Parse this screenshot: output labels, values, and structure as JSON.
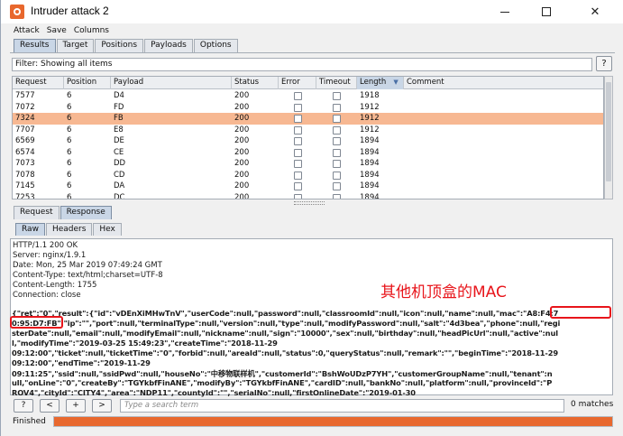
{
  "window": {
    "title": "Intruder attack 2",
    "min_label": "",
    "close_label": "✕"
  },
  "menu": [
    "Attack",
    "Save",
    "Columns"
  ],
  "tabs": [
    "Results",
    "Target",
    "Positions",
    "Payloads",
    "Options"
  ],
  "filter": {
    "text": "Filter: Showing all items",
    "help": "?"
  },
  "table": {
    "columns": [
      "Request",
      "Position",
      "Payload",
      "Status",
      "Error",
      "Timeout",
      "Length",
      "Comment"
    ],
    "sorted_column": "Length",
    "rows": [
      {
        "request": "7577",
        "position": "6",
        "payload": "D4",
        "status": "200",
        "length": "1918"
      },
      {
        "request": "7072",
        "position": "6",
        "payload": "FD",
        "status": "200",
        "length": "1912"
      },
      {
        "request": "7324",
        "position": "6",
        "payload": "FB",
        "status": "200",
        "length": "1912",
        "selected": true
      },
      {
        "request": "7707",
        "position": "6",
        "payload": "E8",
        "status": "200",
        "length": "1912"
      },
      {
        "request": "6569",
        "position": "6",
        "payload": "DE",
        "status": "200",
        "length": "1894"
      },
      {
        "request": "6574",
        "position": "6",
        "payload": "CE",
        "status": "200",
        "length": "1894"
      },
      {
        "request": "7073",
        "position": "6",
        "payload": "DD",
        "status": "200",
        "length": "1894"
      },
      {
        "request": "7078",
        "position": "6",
        "payload": "CD",
        "status": "200",
        "length": "1894"
      },
      {
        "request": "7145",
        "position": "6",
        "payload": "DA",
        "status": "200",
        "length": "1894"
      },
      {
        "request": "7253",
        "position": "6",
        "payload": "DC",
        "status": "200",
        "length": "1894"
      }
    ]
  },
  "rr_tabs": [
    "Request",
    "Response"
  ],
  "view_tabs": [
    "Raw",
    "Headers",
    "Hex"
  ],
  "response": {
    "headers": [
      "HTTP/1.1 200 OK",
      "Server: nginx/1.9.1",
      "Date: Mon, 25 Mar 2019 07:49:24 GMT",
      "Content-Type: text/html;charset=UTF-8",
      "Content-Length: 1755",
      "Connection: close"
    ],
    "annotation": "其他机顶盒的MAC",
    "body_lines": [
      "{\"ret\":\"0\",\"result\":{\"id\":\"vDEnXiMHwTnV\",\"userCode\":null,\"password\":null,\"classroomId\":null,\"icon\":null,\"name\":null,\"mac\":\"A8:F4:7",
      "0:95:D7:FB\",\"ip\":\"\",\"port\":null,\"terminalType\":null,\"version\":null,\"type\":null,\"modifyPassword\":null,\"salt\":\"4d3bea\",\"phone\":null,\"regi",
      "sterDate\":null,\"email\":null,\"modifyEmail\":null,\"nickname\":null,\"sign\":\"10000\",\"sex\":null,\"birthday\":null,\"headPicUrl\":null,\"active\":nul",
      "l,\"modifyTime\":\"2019-03-25 15:49:23\",\"createTime\":\"2018-11-29",
      "09:12:00\",\"ticket\":null,\"ticketTime\":\"0\",\"forbid\":null,\"areaId\":null,\"status\":0,\"queryStatus\":null,\"remark\":\"\",\"beginTime\":\"2018-11-29",
      "09:12:00\",\"endTime\":\"2019-11-29",
      "09:11:25\",\"ssid\":null,\"ssidPwd\":null,\"houseNo\":\"中移物联样机\",\"customerId\":\"BshWoUDzP7YH\",\"customerGroupName\":null,\"tenant\":n",
      "ull,\"onLine\":\"0\",\"createBy\":\"TGYkbfFinANE\",\"modifyBy\":\"TGYkbfFinANE\",\"cardID\":null,\"bankNo\":null,\"platform\":null,\"provinceId\":\"P",
      "ROV4\",\"cityId\":\"CITY4\",\"area\":\"NDP11\",\"countyId\":\"\",\"serialNo\":null,\"firstOnlineDate\":\"2019-01-30"
    ]
  },
  "search": {
    "buttons": [
      "?",
      "<",
      "+",
      ">"
    ],
    "placeholder": "Type a search term",
    "matches": "0 matches"
  },
  "status": {
    "label": "Finished",
    "progress": 1.0,
    "color": "#e8682e"
  }
}
